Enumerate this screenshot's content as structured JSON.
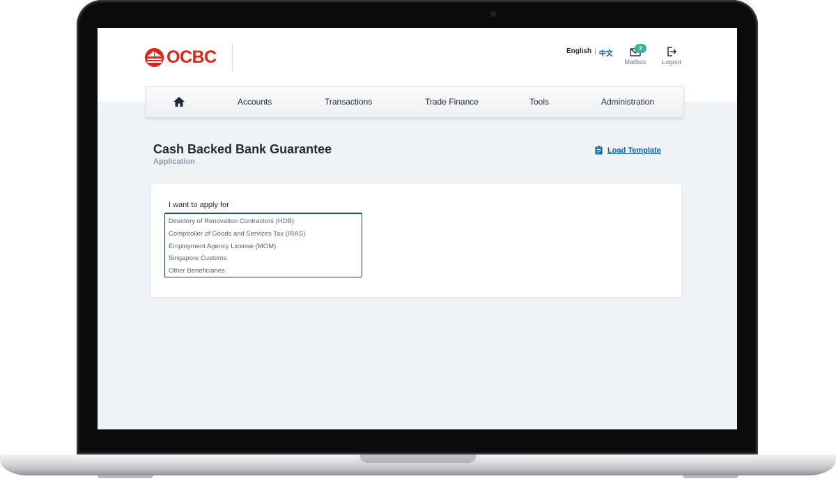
{
  "app": {
    "brand": "OCBC"
  },
  "header": {
    "lang_english": "English",
    "lang_separator": "|",
    "lang_chinese": "中文",
    "mailbox_label": "Mailbox",
    "mailbox_count": "2",
    "logout_label": "Logout"
  },
  "nav": {
    "items": [
      {
        "label": "Accounts"
      },
      {
        "label": "Transactions"
      },
      {
        "label": "Trade Finance"
      },
      {
        "label": "Tools"
      },
      {
        "label": "Administration"
      }
    ]
  },
  "page": {
    "title": "Cash Backed Bank Guarantee",
    "subtitle": "Application",
    "load_template": "Load Template"
  },
  "form": {
    "label": "I want to apply for",
    "options": [
      "Directory of Renovation Contractors (HDB)",
      "Comptroller of Goods and Services Tax (IRAS)",
      "Employment Agency License (MOM)",
      "Singapore Customs",
      "Other Beneficiaries"
    ]
  },
  "colors": {
    "brand_red": "#e2231a",
    "accent_blue": "#0b5ea8",
    "badge_teal": "#2fb8a0",
    "page_bg": "#eff3f6"
  },
  "icons": [
    "home-icon",
    "mail-icon",
    "logout-icon",
    "clipboard-icon",
    "ocbc-logo-mark"
  ]
}
